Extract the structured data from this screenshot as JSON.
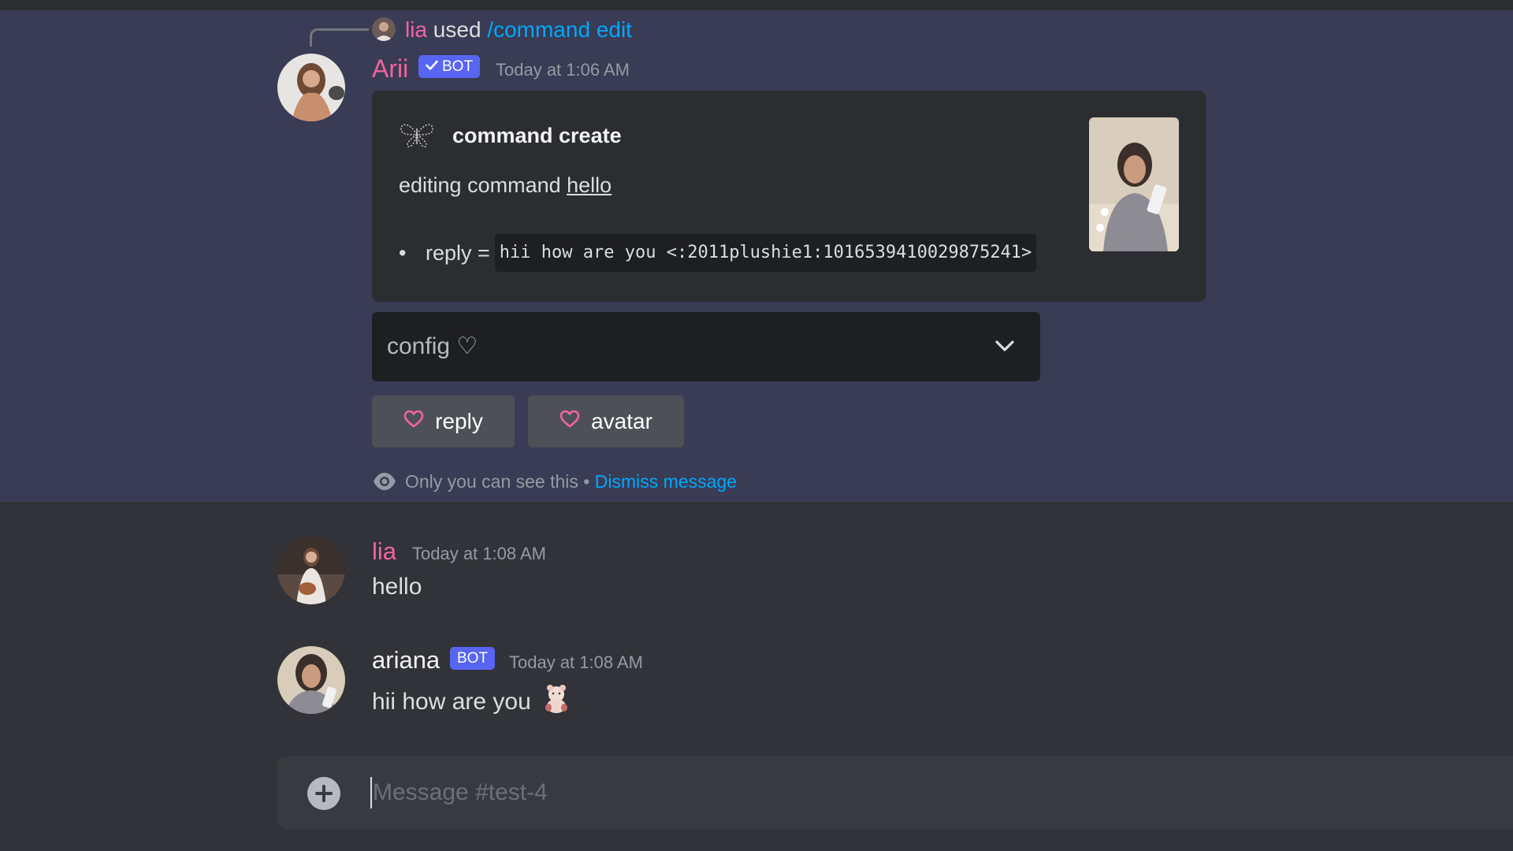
{
  "colors": {
    "background": "#313338",
    "ephemeral_bg": "#393c54",
    "embed_bg": "#2b2d31",
    "username_pink": "#f2639f",
    "link_blue": "#00a8fc",
    "bot_tag": "#5865f2",
    "button_bg": "#4e5058",
    "select_bg": "#1e1f22"
  },
  "reply_context": {
    "user": "lia",
    "used_text": "used",
    "command": "/command edit"
  },
  "bot_message": {
    "username": "Arii",
    "tag": "BOT",
    "verified_icon": "checkmark-icon",
    "timestamp": "Today at 1:06 AM",
    "embed": {
      "author_icon": "butterfly-icon",
      "title": "command create",
      "description_prefix": "editing command",
      "description_link": "hello",
      "bullet_label": "reply =",
      "bullet_code": "hii how are you <:2011plushie1:1016539410029875241>"
    },
    "select": {
      "value": "config ♡",
      "icon": "chevron-down-icon"
    },
    "buttons": [
      {
        "label": "reply",
        "icon": "heart-icon"
      },
      {
        "label": "avatar",
        "icon": "heart-icon"
      }
    ],
    "ephemeral_note": "Only you can see this",
    "ephemeral_sep": "•",
    "dismiss_label": "Dismiss message",
    "ephemeral_icon": "eye-icon"
  },
  "messages": [
    {
      "username": "lia",
      "timestamp": "Today at 1:08 AM",
      "text": "hello"
    },
    {
      "username": "ariana",
      "tag": "BOT",
      "timestamp": "Today at 1:08 AM",
      "text": "hii how are you",
      "emoji": "plushie-emoji"
    }
  ],
  "composer": {
    "placeholder": "Message #test-4",
    "add_icon": "plus-circle-icon"
  }
}
